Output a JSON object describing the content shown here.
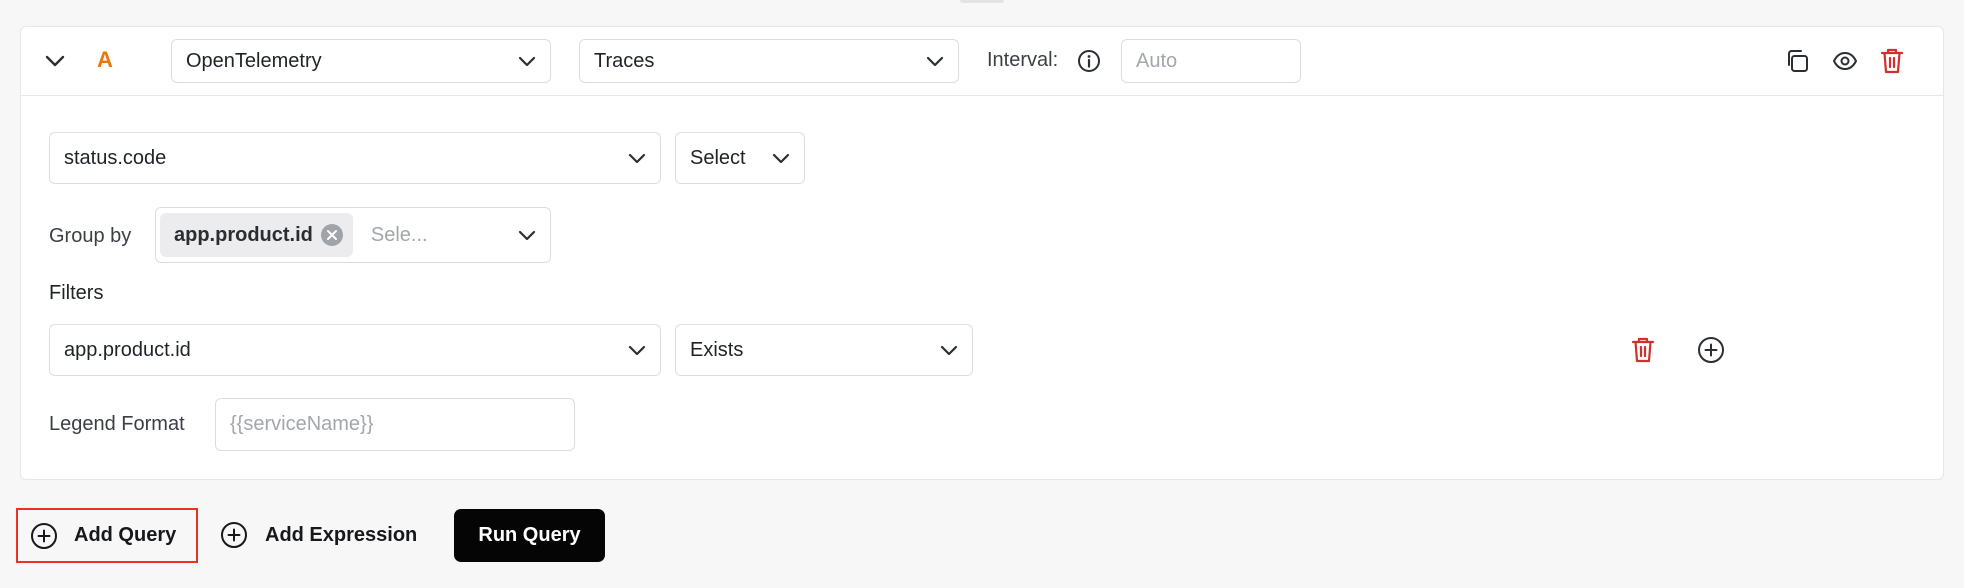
{
  "query": {
    "letter": "A",
    "data_source": "OpenTelemetry",
    "signal": "Traces",
    "interval_label": "Interval:",
    "interval_placeholder": "Auto",
    "metric": "status.code",
    "aggregation": "Select",
    "group_by_label": "Group by",
    "group_by_chip": "app.product.id",
    "group_by_placeholder": "Sele...",
    "filters_label": "Filters",
    "filter": {
      "key": "app.product.id",
      "operator": "Exists"
    },
    "legend_label": "Legend Format",
    "legend_placeholder": "{{serviceName}}"
  },
  "actions": {
    "add_query": "Add Query",
    "add_expression": "Add Expression",
    "run_query": "Run Query"
  },
  "colors": {
    "accent_letter": "#e8780c",
    "danger": "#d32f2f",
    "highlight_border": "#e8341c",
    "run_button_bg": "#050505"
  },
  "icons": [
    "chevron-down-icon",
    "info-icon",
    "copy-icon",
    "eye-icon",
    "trash-icon",
    "close-circle-icon",
    "plus-circle-icon"
  ]
}
